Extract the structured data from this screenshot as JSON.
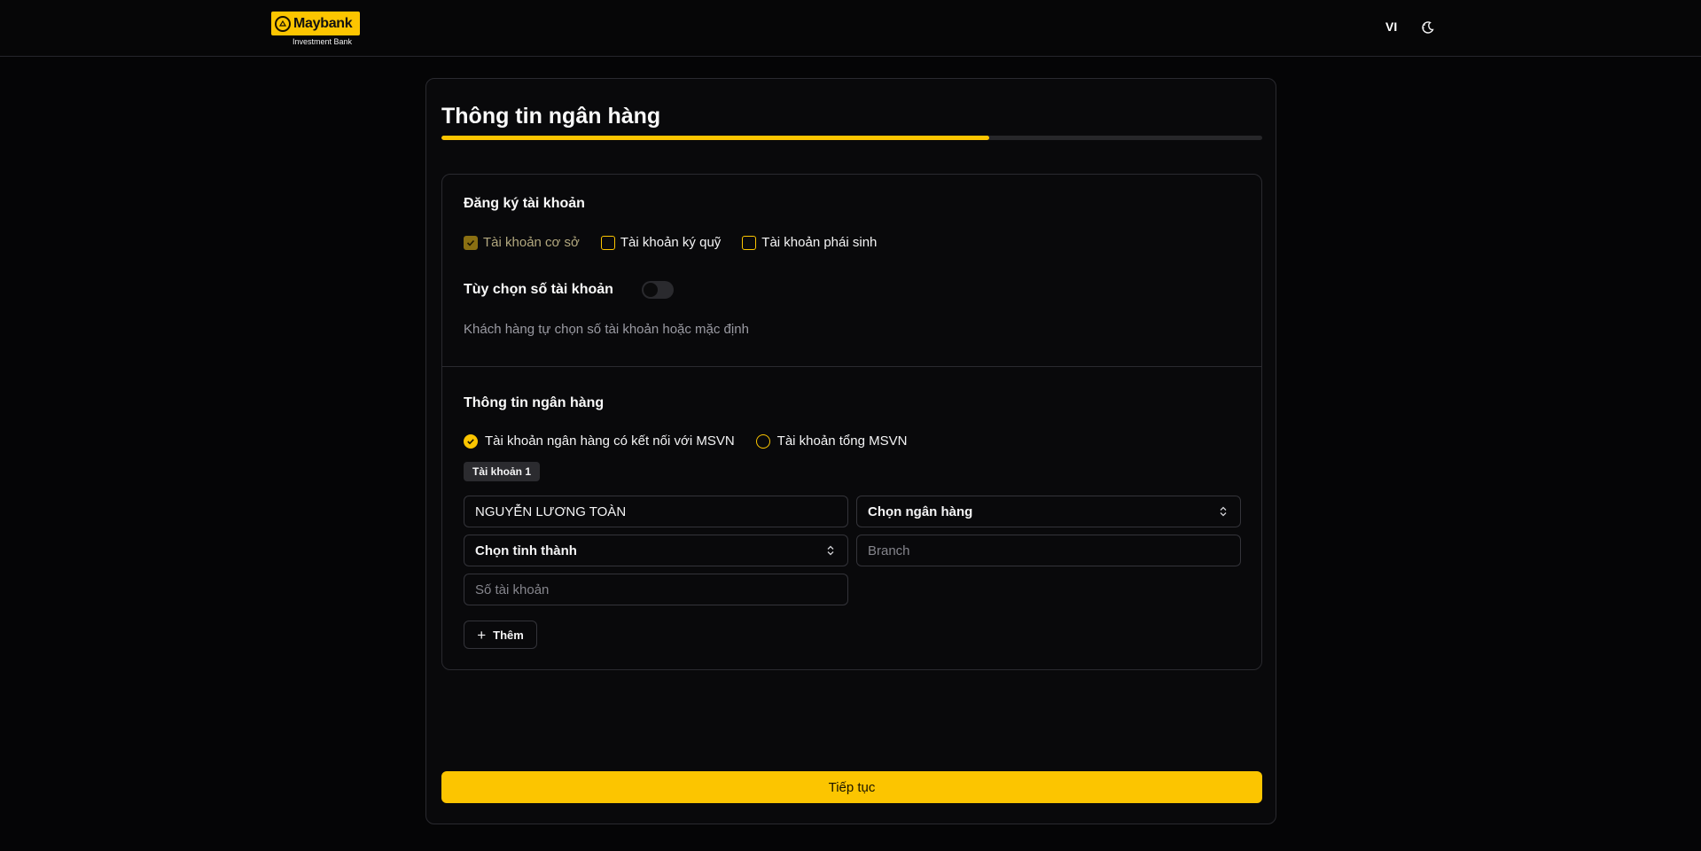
{
  "header": {
    "logo_text": "Maybank",
    "logo_sub": "Investment Bank",
    "language": "VI",
    "theme_icon": "moon-sun-icon"
  },
  "page": {
    "title": "Thông tin ngân hàng",
    "progress_percent": 66.7,
    "accent_color": "#fcc500"
  },
  "account_registration": {
    "title": "Đăng ký tài khoản",
    "options": [
      {
        "label": "Tài khoản cơ sở",
        "checked": true,
        "disabled": true
      },
      {
        "label": "Tài khoản ký quỹ",
        "checked": false
      },
      {
        "label": "Tài khoản phái sinh",
        "checked": false
      }
    ],
    "custom_number_label": "Tùy chọn số tài khoản",
    "custom_number_enabled": false,
    "helper_text": "Khách hàng tự chọn số tài khoản hoặc mặc định"
  },
  "bank_info": {
    "title": "Thông tin ngân hàng",
    "radios": [
      {
        "label": "Tài khoản ngân hàng có kết nối với MSVN",
        "selected": true
      },
      {
        "label": "Tài khoản tổng MSVN",
        "selected": false
      }
    ],
    "account_tag": "Tài khoản 1",
    "account_holder": "NGUYỄN LƯƠNG TOÀN",
    "bank_select": "Chọn ngân hàng",
    "province_select": "Chọn tỉnh thành",
    "branch_placeholder": "Branch",
    "account_number_placeholder": "Số tài khoản",
    "add_label": "Thêm"
  },
  "continue_label": "Tiếp tục"
}
